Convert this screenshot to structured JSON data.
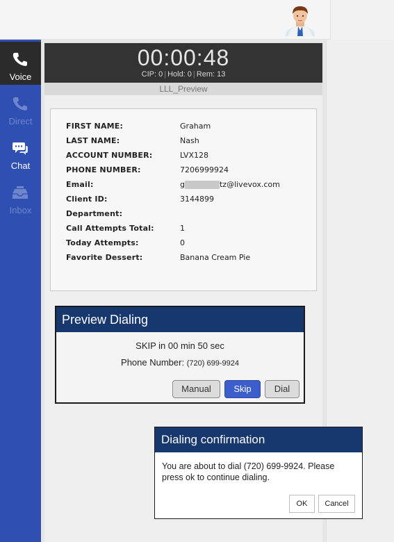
{
  "sidebar": {
    "items": [
      {
        "label": "Voice",
        "icon": "phone-icon",
        "active": true
      },
      {
        "label": "Direct",
        "icon": "phone-icon",
        "active": false
      },
      {
        "label": "Chat",
        "icon": "chat-icon",
        "active": false
      },
      {
        "label": "Inbox",
        "icon": "inbox-icon",
        "active": false
      }
    ]
  },
  "call": {
    "timer": "00:00:48",
    "cip": "CIP: 0",
    "hold": "Hold: 0",
    "rem": "Rem: 13",
    "campaign": "LLL_Preview"
  },
  "customer": {
    "fields": [
      {
        "label": "FIRST NAME:",
        "value": "Graham"
      },
      {
        "label": "LAST NAME:",
        "value": "Nash"
      },
      {
        "label": "ACCOUNT NUMBER:",
        "value": "LVX128"
      },
      {
        "label": "PHONE NUMBER:",
        "value": "7206999924"
      },
      {
        "label": "Email:",
        "value_prefix": "g",
        "value_suffix": "tz@livevox.com"
      },
      {
        "label": "Client ID:",
        "value": "3144899"
      },
      {
        "label": "Department:",
        "value": ""
      },
      {
        "label": "Call Attempts Total:",
        "value": "1"
      },
      {
        "label": "Today Attempts:",
        "value": "0"
      },
      {
        "label": "Favorite Dessert:",
        "value": "Banana Cream Pie"
      }
    ]
  },
  "preview": {
    "title": "Preview Dialing",
    "skip_text": "SKIP in 00 min 50 sec",
    "phone_label": "Phone Number:",
    "phone_value": "(720) 699-9924",
    "buttons": {
      "manual": "Manual",
      "skip": "Skip",
      "dial": "Dial"
    }
  },
  "confirm": {
    "title": "Dialing confirmation",
    "message": "You are about to dial (720) 699-9924. Please press ok to continue dialing.",
    "ok": "OK",
    "cancel": "Cancel"
  },
  "colors": {
    "sidebar": "#2f4fb3",
    "header_blue": "#16386f",
    "timer_bg": "#333333",
    "primary_button": "#3b5ecc"
  }
}
